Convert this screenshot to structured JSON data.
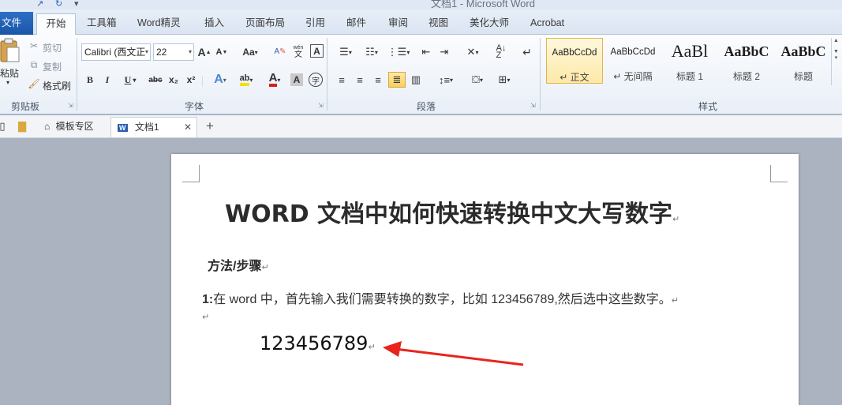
{
  "window": {
    "title": "文档1 - Microsoft Word"
  },
  "tabs": [
    "文件",
    "开始",
    "工具箱",
    "Word精灵",
    "插入",
    "页面布局",
    "引用",
    "邮件",
    "审阅",
    "视图",
    "美化大师",
    "Acrobat"
  ],
  "clipboard": {
    "paste": "粘贴",
    "cut": "剪切",
    "copy": "复制",
    "format_painter": "格式刷",
    "label": "剪贴板"
  },
  "font": {
    "name": "Calibri (西文正",
    "size": "22",
    "label": "字体",
    "grow": "A",
    "shrink": "A",
    "change_case": "Aa",
    "bold": "B",
    "italic": "I",
    "underline": "U",
    "strike": "abc",
    "subscript": "x₂",
    "superscript": "x²",
    "text_effect": "A",
    "highlight": "ab",
    "font_color": "A",
    "char_shading": "A",
    "enclose": "字",
    "phonetic": "wén",
    "clear": "A",
    "border": "A",
    "highlight_color": "#f5e10a",
    "font_color_value": "#d42020"
  },
  "paragraph": {
    "label": "段落"
  },
  "styles": {
    "label": "样式",
    "items": [
      {
        "sample": "AaBbCcDd",
        "name": "↵ 正文"
      },
      {
        "sample": "AaBbCcDd",
        "name": "↵ 无间隔"
      },
      {
        "sample": "AaBl",
        "name": "标题 1"
      },
      {
        "sample": "AaBbC",
        "name": "标题 2"
      },
      {
        "sample": "AaBbC",
        "name": "标题"
      }
    ]
  },
  "doc_tabs": {
    "templates": "模板专区",
    "doc1": "文档1",
    "close": "✕",
    "add": "+"
  },
  "document": {
    "title": "WORD 文档中如何快速转换中文大写数字",
    "method": "方法/步骤",
    "step_num": "1:",
    "step_text": "在 word 中，首先输入我们需要转换的数字，比如 123456789,然后选中这些数字。",
    "number": "123456789",
    "pilcrow": "↵",
    "arrow_color": "#e8241c"
  }
}
